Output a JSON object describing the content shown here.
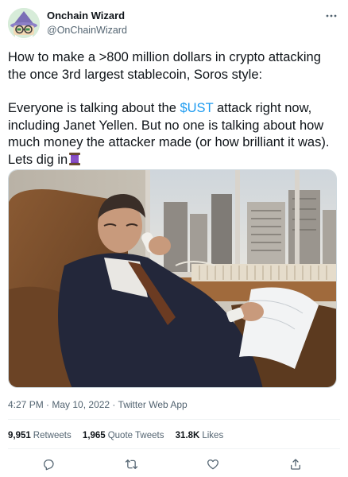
{
  "author": {
    "display_name": "Onchain Wizard",
    "handle": "@OnChainWizard",
    "avatar_icon": "wizard-avatar-icon"
  },
  "tweet": {
    "paragraph1": "How to make a >800 million dollars in crypto attacking the once 3rd largest stablecoin, Soros style:",
    "p2_before": "Everyone is talking about the ",
    "cashtag": "$UST",
    "p2_after": " attack right now, including Janet Yellen. But no one is talking about how much money the attacker made (or how brilliant it was). Lets dig in",
    "emoji_icon": "thread-spool-icon"
  },
  "meta": {
    "time": "4:27 PM",
    "separator": " · ",
    "date": "May 10, 2022",
    "source": "Twitter Web App"
  },
  "stats": {
    "retweets_count": "9,951",
    "retweets_label": "Retweets",
    "quotes_count": "1,965",
    "quotes_label": "Quote Tweets",
    "likes_count": "31.8K",
    "likes_label": "Likes"
  },
  "colors": {
    "text": "#0f1419",
    "secondary": "#536471",
    "link": "#1d9bf0",
    "divider": "#eff3f4"
  }
}
